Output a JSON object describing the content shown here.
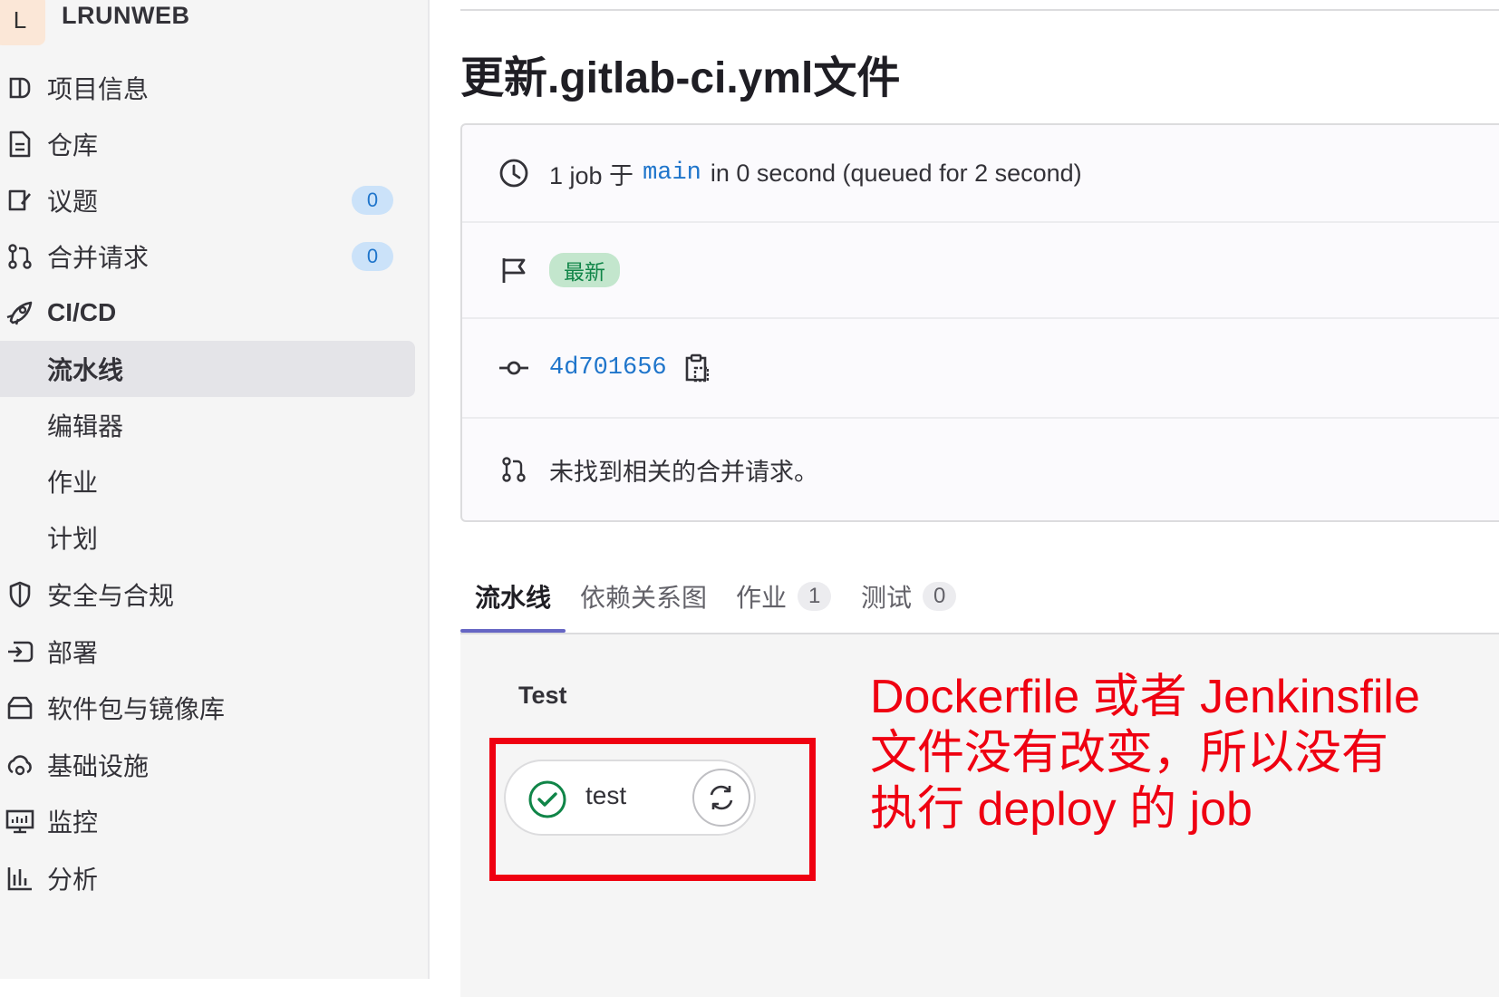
{
  "colors": {
    "accent_link": "#1f75cb",
    "success": "#108548",
    "annotation": "#ef0011",
    "tab_active": "#6666c4",
    "sidebar_bg": "#f5f5f5"
  },
  "project": {
    "avatar_letter": "L",
    "name": "LRUNWEB"
  },
  "sidebar": {
    "items": [
      {
        "label": "项目信息",
        "icon": "project-info-icon"
      },
      {
        "label": "仓库",
        "icon": "repository-file-icon"
      },
      {
        "label": "议题",
        "icon": "issues-icon",
        "badge": "0"
      },
      {
        "label": "合并请求",
        "icon": "merge-request-icon",
        "badge": "0"
      },
      {
        "label": "CI/CD",
        "icon": "rocket-icon"
      },
      {
        "label": "流水线",
        "active": true
      },
      {
        "label": "编辑器"
      },
      {
        "label": "作业"
      },
      {
        "label": "计划"
      },
      {
        "label": "安全与合规",
        "icon": "shield-icon"
      },
      {
        "label": "部署",
        "icon": "deployments-icon"
      },
      {
        "label": "软件包与镜像库",
        "icon": "package-icon"
      },
      {
        "label": "基础设施",
        "icon": "cloud-gear-icon"
      },
      {
        "label": "监控",
        "icon": "monitor-icon"
      },
      {
        "label": "分析",
        "icon": "chart-icon"
      }
    ]
  },
  "main": {
    "title": "更新.gitlab-ci.yml文件",
    "info": {
      "job_count": "1 job 于",
      "branch": "main",
      "duration": "in 0 second (queued for 2 second)",
      "latest_badge": "最新",
      "commit_sha": "4d701656",
      "no_mr_text": "未找到相关的合并请求。"
    },
    "tabs": [
      {
        "label": "流水线",
        "active": true
      },
      {
        "label": "依赖关系图"
      },
      {
        "label": "作业",
        "count": "1"
      },
      {
        "label": "测试",
        "count": "0"
      }
    ],
    "graph": {
      "stage_name": "Test",
      "job_name": "test",
      "job_status": "passed"
    },
    "annotation": {
      "line1": "Dockerfile 或者 Jenkinsfile",
      "line2": "文件没有改变，所以没有",
      "line3": "执行  deploy 的 job"
    }
  }
}
